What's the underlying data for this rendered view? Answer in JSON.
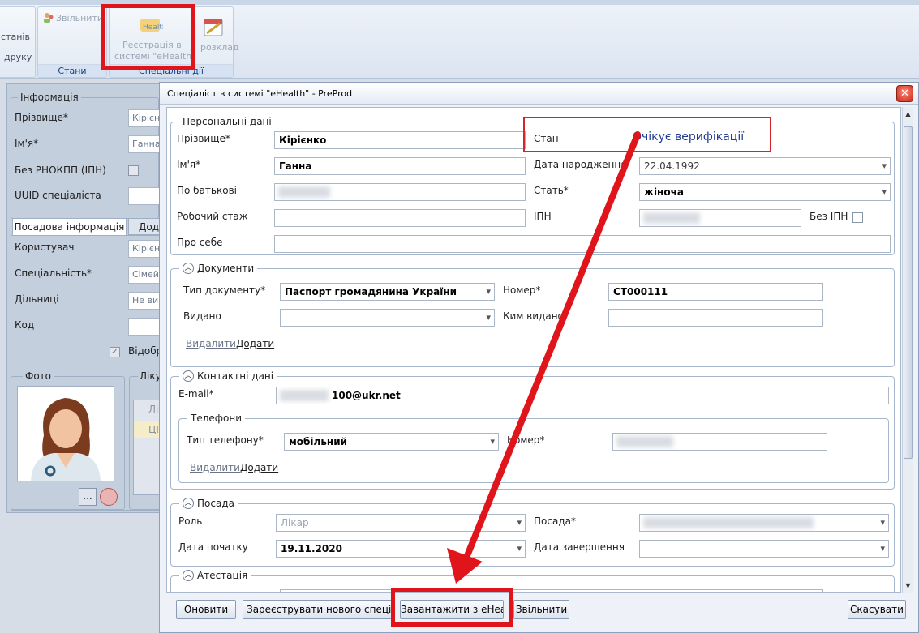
{
  "ribbon": {
    "states_stub": "станів",
    "print_stub": "друку",
    "dismiss": "Звільнити",
    "register_line1": "Реєстрація в",
    "register_line2": "системі \"eHealth\"",
    "schedule_stub": "розклад",
    "group_states": "Стани",
    "group_special": "Спеціальні дії"
  },
  "left_panel": {
    "info_legend": "Інформація",
    "surname_label": "Прізвище*",
    "surname_value": "Кірієн",
    "name_label": "Ім'я*",
    "name_value": "Ганна",
    "no_rnokpp_label": "Без РНОКПП (ІПН)",
    "uuid_label": "UUID спеціаліста",
    "tab_position": "Посадова інформація",
    "tab_extra": "Дода",
    "user_label": "Користувач",
    "user_value": "Кірієн",
    "specialty_label": "Спеціальність*",
    "specialty_value": "Сімей",
    "districts_label": "Дільниці",
    "districts_value": "Не ви",
    "code_label": "Код",
    "display_label": "Відобр",
    "photo_label": "Фото",
    "doctor_stub": "Лікує",
    "grid_stub1": "Лі",
    "grid_stub2": "ЦІ",
    "photo_btn": "..."
  },
  "dialog": {
    "title": "Спеціаліст в системі \"eHealth\" - PreProd",
    "close_glyph": "✕",
    "personal": {
      "legend": "Персональні дані",
      "surname_label": "Прізвище*",
      "surname_value": "Кірієнко",
      "name_label": "Ім'я*",
      "name_value": "Ганна",
      "patronymic_label": "По батькові",
      "experience_label": "Робочий стаж",
      "about_label": "Про себе",
      "state_label": "Стан",
      "state_value": "Очікує верифікації",
      "birth_label": "Дата народження",
      "birth_value": "22.04.1992",
      "gender_label": "Стать*",
      "gender_value": "жіноча",
      "ipn_label": "ІПН",
      "no_ipn_label": "Без ІПН"
    },
    "documents": {
      "legend": "Документи",
      "type_label": "Тип документу*",
      "type_value": "Паспорт громадянина України",
      "number_label": "Номер*",
      "number_value": "СТ000111",
      "issued_label": "Видано",
      "issued_by_label": "Ким видано",
      "delete_link": "Видалити",
      "add_link": "Додати"
    },
    "contacts": {
      "legend": "Контактні дані",
      "email_label": "E-mail*",
      "email_value": "100@ukr.net",
      "phones_legend": "Телефони",
      "phone_type_label": "Тип телефону*",
      "phone_type_value": "мобільний",
      "phone_number_label": "Номер*",
      "delete_link": "Видалити",
      "add_link": "Додати"
    },
    "position": {
      "legend": "Посада",
      "role_label": "Роль",
      "role_value": "Лікар",
      "position_label": "Посада*",
      "start_label": "Дата початку",
      "start_value": "19.11.2020",
      "end_label": "Дата завершення"
    },
    "attestation": {
      "legend": "Атестація"
    },
    "buttons": {
      "update": "Оновити",
      "register_new": "Зареєструвати нового спеціаліста",
      "load": "Завантажити з eHealth",
      "dismiss": "Звільнити",
      "cancel": "Скасувати"
    }
  },
  "colors": {
    "highlight_red": "#e0141b",
    "state_text": "#1f3a93"
  }
}
